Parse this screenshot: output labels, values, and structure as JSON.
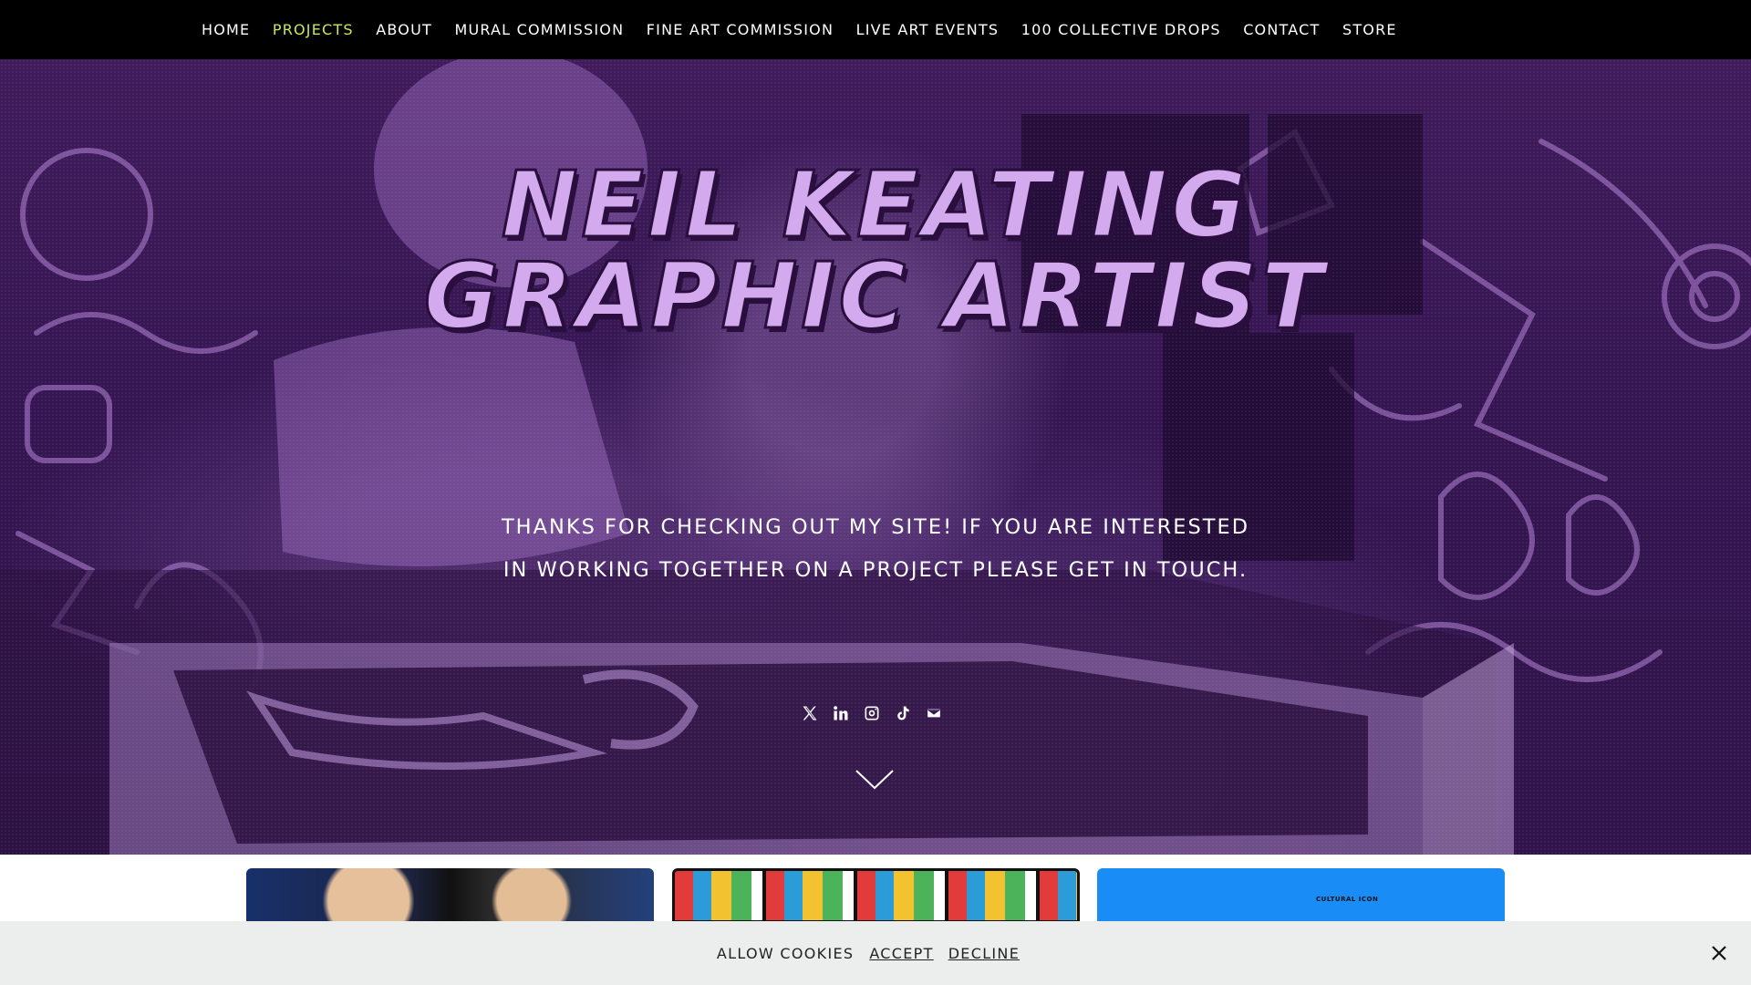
{
  "nav": {
    "items": [
      {
        "label": "HOME",
        "active": false
      },
      {
        "label": "PROJECTS",
        "active": true
      },
      {
        "label": "ABOUT",
        "active": false
      },
      {
        "label": "MURAL COMMISSION",
        "active": false
      },
      {
        "label": "FINE ART COMMISSION",
        "active": false
      },
      {
        "label": "LIVE ART EVENTS",
        "active": false
      },
      {
        "label": "100 COLLECTIVE DROPS",
        "active": false
      },
      {
        "label": "CONTACT",
        "active": false
      },
      {
        "label": "STORE",
        "active": false
      }
    ],
    "active_color": "#c8ea57"
  },
  "hero": {
    "title_line1": "NEIL KEATING",
    "title_line2": "GRAPHIC ARTIST",
    "tagline": "THANKS FOR CHECKING OUT MY SITE! IF YOU ARE INTERESTED IN WORKING TOGETHER ON A PROJECT PLEASE GET IN TOUCH.",
    "title_color": "#d4aaee",
    "background_color": "#3a1754",
    "social_icons": [
      "x-icon",
      "linkedin-icon",
      "instagram-icon",
      "tiktok-icon",
      "email-icon"
    ],
    "scroll_icon": "chevron-down-icon"
  },
  "cards": {
    "badge_text": "CULTURAL ICON",
    "card3_color": "#1a8cf5"
  },
  "cookie": {
    "label": "ALLOW COOKIES",
    "accept": "ACCEPT",
    "decline": "DECLINE",
    "close_icon": "close-icon"
  }
}
